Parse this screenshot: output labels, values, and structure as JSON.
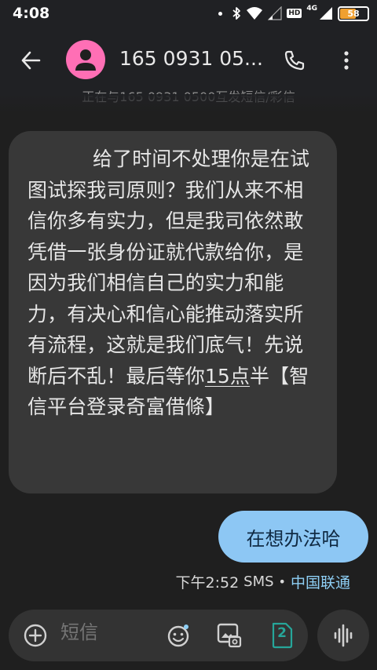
{
  "status_bar": {
    "time": "4:08",
    "hd_label": "HD",
    "network_label": "4G",
    "battery_level": "58",
    "battery_fraction": 0.58
  },
  "header": {
    "contact_name": "165 0931 05...",
    "notice_text": "正在与165 0931 0500互发短信/彩信",
    "icons": [
      "back-arrow-icon",
      "person-icon",
      "phone-icon",
      "more-vert-icon"
    ]
  },
  "messages": {
    "incoming": {
      "text_before_link": "给了时间不处理你是在试图试探我司原则？我们从来不相信你多有实力，但是我司依然敢凭借一张身份证就代款给你，是因为我们相信自己的实力和能力，有决心和信心能推动落实所有流程，这就是我们底气！先说断后不乱！最后等你",
      "link_text": "15点",
      "text_after_link": "半【智信平台登录奇富借條】"
    },
    "outgoing": {
      "text": "在想办法哈"
    },
    "meta": {
      "time": "下午2:52",
      "type": "SMS",
      "separator": "•",
      "carrier": "中国联通"
    }
  },
  "compose": {
    "placeholder": "短信",
    "sim_label": "2"
  },
  "colors": {
    "background": "#1f1f1f",
    "incoming_bubble": "#383838",
    "outgoing_bubble": "#8dc7f4",
    "avatar": "#ff6fb5",
    "carrier_link": "#8ecff5",
    "sim_badge": "#26a69a",
    "battery": "#f0a030"
  }
}
